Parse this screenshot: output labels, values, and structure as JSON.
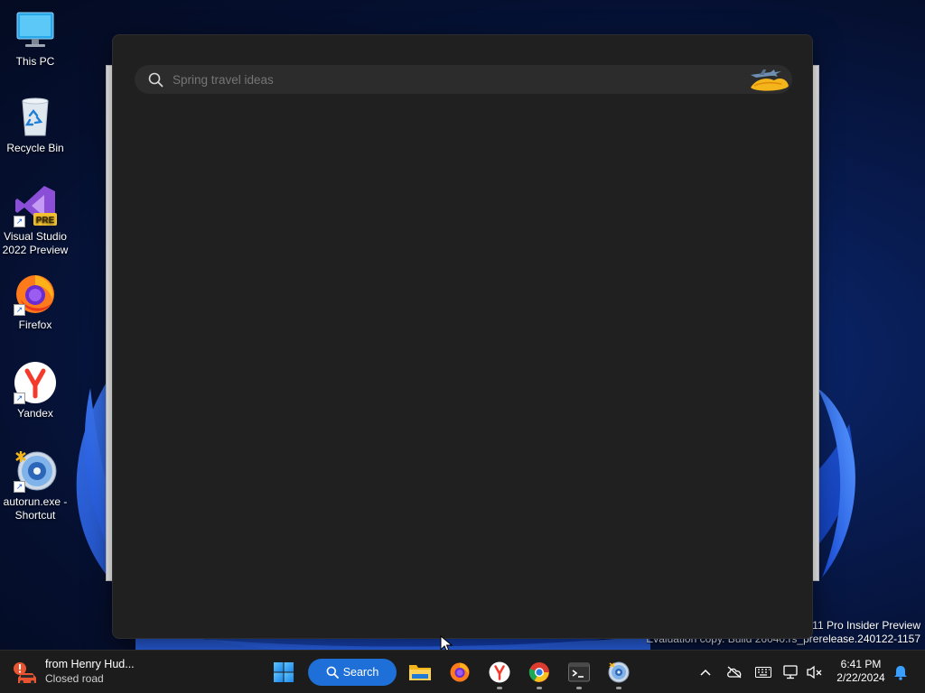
{
  "desktop": {
    "icons": [
      {
        "label": "This PC",
        "icon": "monitor-icon"
      },
      {
        "label": "Recycle Bin",
        "icon": "recycle-bin-icon"
      },
      {
        "label": "Visual Studio 2022 Preview",
        "icon": "visual-studio-icon",
        "badge": "PRE"
      },
      {
        "label": "Firefox",
        "icon": "firefox-icon"
      },
      {
        "label": "Yandex",
        "icon": "yandex-icon"
      },
      {
        "label": "autorun.exe - Shortcut",
        "icon": "disc-icon"
      }
    ]
  },
  "search_flyout": {
    "placeholder": "Spring travel ideas",
    "value": "",
    "highlight_icon": "airplane-travel-icon"
  },
  "watermark": {
    "line1": "s 11 Pro Insider Preview",
    "line2": "Evaluation copy. Build 26040.rs_prerelease.240122-1157"
  },
  "taskbar": {
    "widget": {
      "title": "from Henry Hud...",
      "subtitle": "Closed road",
      "icon": "traffic-alert-icon"
    },
    "start_icon": "windows-start-icon",
    "search_label": "Search",
    "apps": [
      "file-explorer-icon",
      "firefox-icon",
      "yandex-icon",
      "chrome-icon",
      "terminal-icon",
      "disc-app-icon"
    ],
    "tray": [
      "chevron-up-icon",
      "onedrive-offline-icon",
      "keyboard-icon",
      "network-icon",
      "volume-muted-icon"
    ],
    "clock": {
      "time": "6:41 PM",
      "date": "2/22/2024"
    },
    "notification_icon": "bell-icon"
  },
  "colors": {
    "flyout_bg": "#202020",
    "search_field_bg": "#2c2c2c",
    "search_pill": "#1f6fd8",
    "taskbar_bg": "#1c1c1c"
  }
}
